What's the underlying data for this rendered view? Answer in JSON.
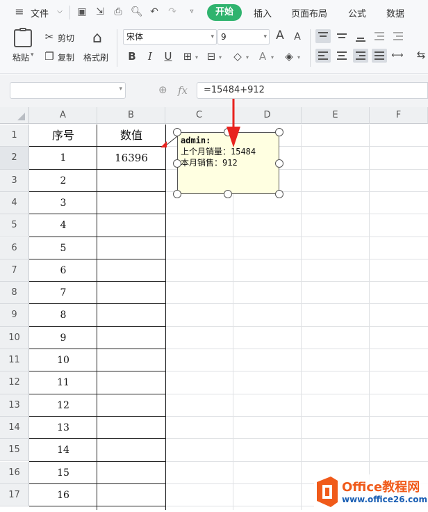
{
  "menubar": {
    "file_label": "文件",
    "tabs": [
      {
        "label": "开始",
        "active": true
      },
      {
        "label": "插入"
      },
      {
        "label": "页面布局"
      },
      {
        "label": "公式"
      },
      {
        "label": "数据"
      }
    ]
  },
  "ribbon": {
    "paste_label": "粘贴",
    "cut_label": "剪切",
    "copy_label": "复制",
    "format_painter_label": "格式刷",
    "font_name": "宋体",
    "font_size": "9",
    "bold": "B",
    "italic": "I",
    "underline": "U",
    "font_grow": "A",
    "font_shrink": "A",
    "font_color": "A"
  },
  "formula_bar": {
    "name_box": "",
    "fx_label": "fx",
    "formula": "=15484+912"
  },
  "grid": {
    "columns": [
      "A",
      "B",
      "C",
      "D",
      "E",
      "F"
    ],
    "rows": [
      "1",
      "2",
      "3",
      "4",
      "5",
      "6",
      "7",
      "8",
      "9",
      "10",
      "11",
      "12",
      "13",
      "14",
      "15",
      "16",
      "17"
    ],
    "header_a": "序号",
    "header_b": "数值",
    "a_values": [
      "1",
      "2",
      "3",
      "4",
      "5",
      "6",
      "7",
      "8",
      "9",
      "10",
      "11",
      "12",
      "13",
      "14",
      "15",
      "16"
    ],
    "b2": "16396"
  },
  "comment": {
    "author": "admin:",
    "line1": "上个月销量：15484",
    "line2": "本月销售：912"
  },
  "watermark": {
    "brand": "Office教程网",
    "url": "www.office26.com"
  },
  "colors": {
    "accent": "#2fb36e",
    "comment_bg": "#ffffe1",
    "arrow": "#e8231f",
    "watermark_orange": "#f05a1a"
  }
}
